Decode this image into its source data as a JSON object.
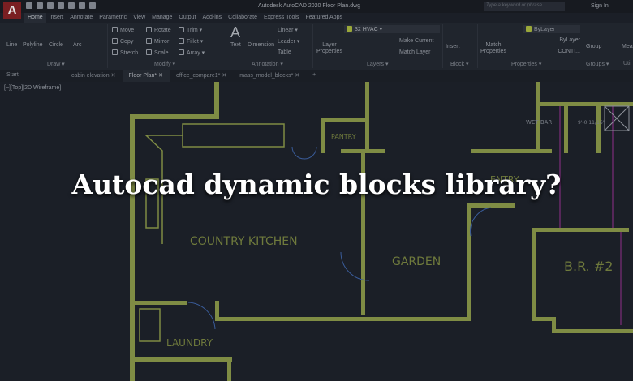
{
  "app": {
    "logo": "A",
    "title": "Autodesk AutoCAD 2020    Floor Plan.dwg",
    "search_placeholder": "Type a keyword or phrase",
    "sign_in": "Sign In"
  },
  "ribbon_tabs": [
    "Home",
    "Insert",
    "Annotate",
    "Parametric",
    "View",
    "Manage",
    "Output",
    "Add-ins",
    "Collaborate",
    "Express Tools",
    "Featured Apps"
  ],
  "draw": {
    "line": "Line",
    "polyline": "Polyline",
    "circle": "Circle",
    "arc": "Arc",
    "panel": "Draw ▾"
  },
  "modify": {
    "move": "Move",
    "rotate": "Rotate",
    "trim": "Trim ▾",
    "copy": "Copy",
    "mirror": "Mirror",
    "fillet": "Fillet ▾",
    "stretch": "Stretch",
    "scale": "Scale",
    "array": "Array ▾",
    "panel": "Modify ▾"
  },
  "annotation": {
    "text": "Text",
    "dimension": "Dimension",
    "linear": "Linear ▾",
    "leader": "Leader ▾",
    "table": "Table",
    "panel": "Annotation ▾"
  },
  "layers": {
    "layer_properties": "Layer Properties",
    "current_layer": "32 HVAC",
    "make_current": "Make Current",
    "match_layer": "Match Layer",
    "panel": "Layers ▾"
  },
  "block": {
    "insert": "Insert",
    "panel": "Block ▾"
  },
  "properties": {
    "match_properties": "Match Properties",
    "color": "ByLayer",
    "lineweight": "ByLayer",
    "linetype": "CONTI...",
    "panel": "Properties ▾"
  },
  "groups": {
    "group": "Group",
    "panel": "Groups ▾"
  },
  "utilities": {
    "measure": "Mea",
    "panel": "Uti"
  },
  "doc_tabs": [
    "Start",
    "cabin elevation",
    "Floor Plan*",
    "office_compare1*",
    "mass_model_blocks*"
  ],
  "viewport_label": "[−][Top][2D Wireframe]",
  "rooms": {
    "pantry": "PANTRY",
    "kitchen": "COUNTRY KITCHEN",
    "garden": "GARDEN",
    "laundry": "LAUNDRY",
    "entry": "ENTRY",
    "wet_bar": "WET BAR",
    "br2": "B.R. #2",
    "dim": "9'-0 11/16\""
  },
  "headline": "Autocad dynamic blocks library?",
  "colors": {
    "wall": "#8c9a4c",
    "door": "#3a5c9a",
    "magenta": "#6a2a6a"
  }
}
